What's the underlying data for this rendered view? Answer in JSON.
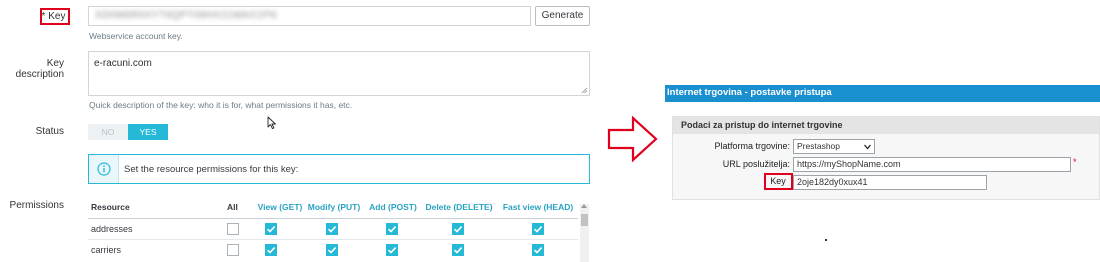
{
  "left": {
    "key_label": "* Key",
    "key_value": "XD0M6R0XYT6QPT09HX21MAX1PN",
    "generate_button": "Generate",
    "key_help": "Webservice account key.",
    "desc_label": "Key description",
    "desc_value": "e-racuni.com",
    "desc_help": "Quick description of the key: who it is for, what permissions it has, etc.",
    "status_label": "Status",
    "status_no": "NO",
    "status_yes": "YES",
    "info_text": "Set the resource permissions for this key:",
    "permissions_label": "Permissions",
    "columns": [
      "Resource",
      "All",
      "View (GET)",
      "Modify (PUT)",
      "Add (POST)",
      "Delete (DELETE)",
      "Fast view (HEAD)"
    ],
    "rows": [
      {
        "resource": "addresses",
        "all": false,
        "get": true,
        "put": true,
        "post": true,
        "delete": true,
        "head": true
      },
      {
        "resource": "carriers",
        "all": false,
        "get": true,
        "put": true,
        "post": true,
        "delete": true,
        "head": true
      }
    ]
  },
  "right": {
    "title": "Internet trgovina - postavke pristupa",
    "section_title": "Podaci za pristup do internet trgovine",
    "platform_label": "Platforma trgovine:",
    "platform_value": "Prestashop",
    "url_label": "URL poslužitelja:",
    "url_value": "https://myShopName.com",
    "required_mark": "*",
    "key_label": "Key",
    "key_value": "2oje182dy0xux41"
  },
  "colors": {
    "accent": "#25b9d7",
    "highlight": "#e0001b",
    "header_bg": "#1a8fd0"
  },
  "icons": [
    "info-icon",
    "check-icon",
    "cursor-icon",
    "arrow-right-icon",
    "chevron-down-icon",
    "resize-grip-icon"
  ]
}
